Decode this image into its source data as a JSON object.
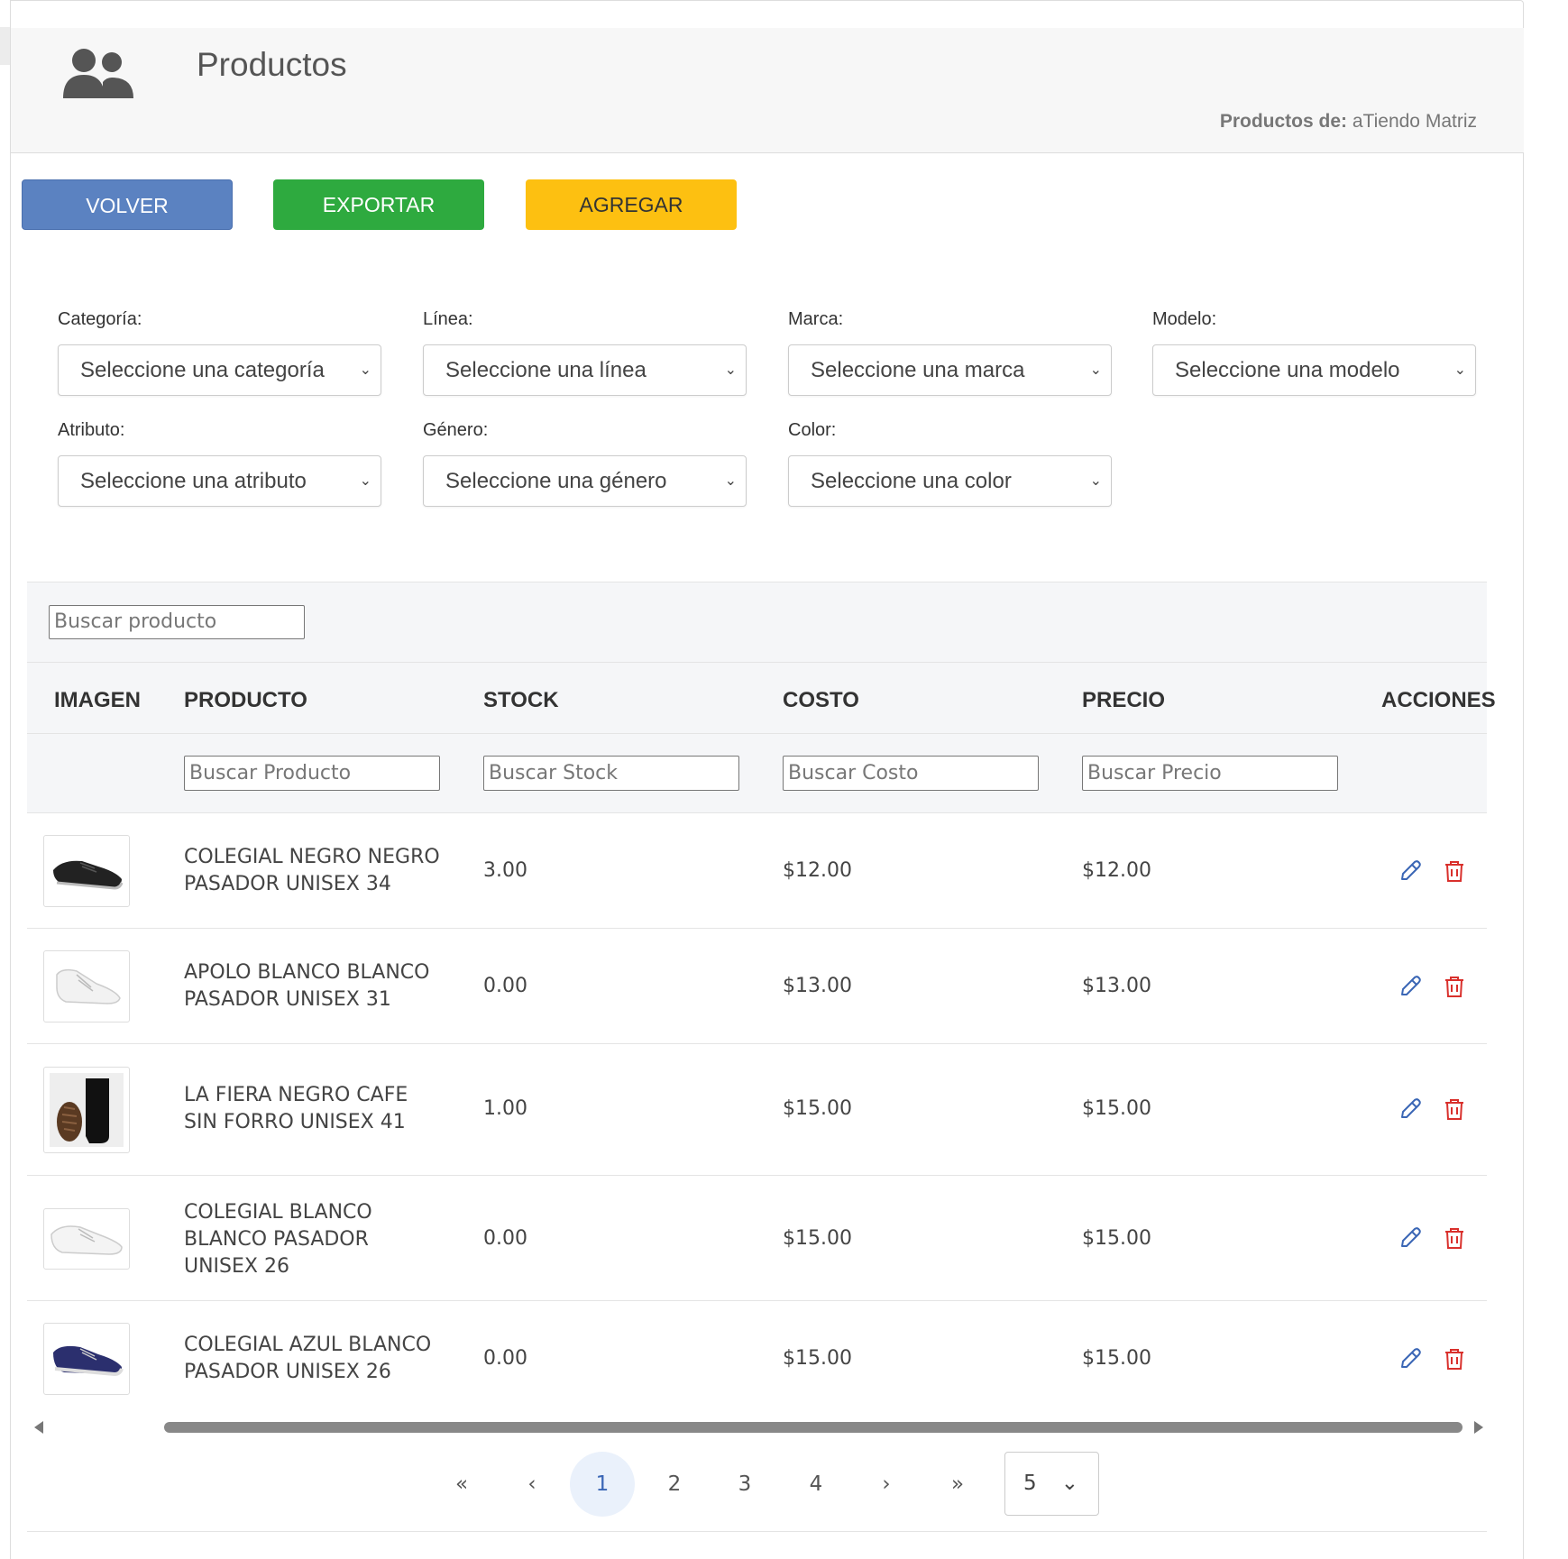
{
  "header": {
    "title": "Productos",
    "owner_label": "Productos de:",
    "owner_value": "aTiendo Matriz",
    "logo_icon": "users-icon"
  },
  "buttons": {
    "back": "VOLVER",
    "export": "EXPORTAR",
    "add": "AGREGAR"
  },
  "filters": [
    {
      "label": "Categoría:",
      "value": "Seleccione una categoría"
    },
    {
      "label": "Línea:",
      "value": "Seleccione una línea"
    },
    {
      "label": "Marca:",
      "value": "Seleccione una marca"
    },
    {
      "label": "Modelo:",
      "value": "Seleccione una modelo"
    },
    {
      "label": "Atributo:",
      "value": "Seleccione una atributo"
    },
    {
      "label": "Género:",
      "value": "Seleccione una género"
    },
    {
      "label": "Color:",
      "value": "Seleccione una color"
    }
  ],
  "search": {
    "placeholder": "Buscar producto"
  },
  "table": {
    "columns": [
      "IMAGEN",
      "PRODUCTO",
      "STOCK",
      "COSTO",
      "PRECIO",
      "ACCIONES"
    ],
    "column_filters": {
      "producto": "Buscar Producto",
      "stock": "Buscar Stock",
      "costo": "Buscar Costo",
      "precio": "Buscar Precio"
    },
    "rows": [
      {
        "name": "COLEGIAL NEGRO NEGRO PASADOR UNISEX 34",
        "stock": "3.00",
        "cost": "$12.00",
        "price": "$12.00",
        "image": "black-shoe"
      },
      {
        "name": "APOLO BLANCO BLANCO PASADOR UNISEX 31",
        "stock": "0.00",
        "cost": "$13.00",
        "price": "$13.00",
        "image": "white-shoe"
      },
      {
        "name": "LA FIERA NEGRO CAFE SIN FORRO UNISEX 41",
        "stock": "1.00",
        "cost": "$15.00",
        "price": "$15.00",
        "image": "black-boot"
      },
      {
        "name": "COLEGIAL BLANCO BLANCO PASADOR UNISEX 26",
        "stock": "0.00",
        "cost": "$15.00",
        "price": "$15.00",
        "image": "white-shoe"
      },
      {
        "name": "COLEGIAL AZUL BLANCO PASADOR UNISEX 26",
        "stock": "0.00",
        "cost": "$15.00",
        "price": "$15.00",
        "image": "blue-shoe"
      }
    ]
  },
  "pagination": {
    "first": "«",
    "prev": "‹",
    "pages": [
      "1",
      "2",
      "3",
      "4"
    ],
    "current": "1",
    "next": "›",
    "last": "»",
    "page_size": "5"
  },
  "colors": {
    "back_button": "#5b82c1",
    "export_button": "#2eaa3f",
    "add_button": "#fdc011",
    "edit_icon": "#3a66b5",
    "delete_icon": "#d9302c"
  }
}
